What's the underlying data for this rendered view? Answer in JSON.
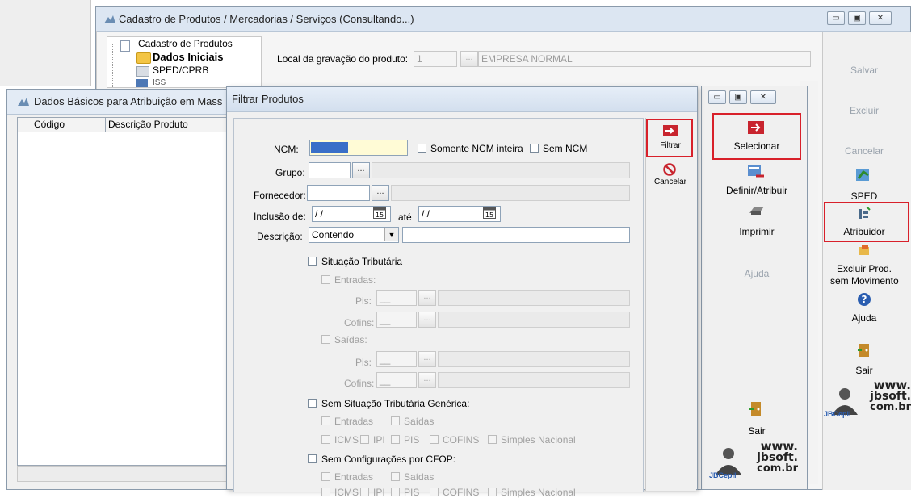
{
  "bg_window": {
    "title": "Cadastro de Produtos / Mercadorias / Serviços (Consultando...)",
    "tree": {
      "root": "Cadastro de Produtos",
      "selected": "Dados Iniciais",
      "item3": "SPED/CPRB",
      "item4": "ISS"
    },
    "storage_label": "Local da gravação do produto:",
    "storage_value": "1",
    "storage_name": "EMPRESA NORMAL",
    "controls": {
      "minimize": "▭",
      "maximize": "▣",
      "close": "✕"
    }
  },
  "right_panel": {
    "salvar": "Salvar",
    "excluir": "Excluir",
    "cancelar": "Cancelar",
    "sped": "SPED",
    "atribuidor": "Atribuidor",
    "excluir_prod_1": "Excluir Prod.",
    "excluir_prod_2": "sem Movimento",
    "ajuda": "Ajuda",
    "sair": "Sair"
  },
  "basic_window": {
    "title": "Dados Básicos para Atribuição em Mass",
    "col_codigo": "Código",
    "col_descricao": "Descrição Produto"
  },
  "middle_panel": {
    "selecionar": "Selecionar",
    "definir": "Definir/Atribuir",
    "imprimir": "Imprimir",
    "ajuda": "Ajuda",
    "sair": "Sair"
  },
  "filter_dialog": {
    "title": "Filtrar Produtos",
    "filtrar": "Filtrar",
    "cancelar": "Cancelar",
    "ncm_label": "NCM:",
    "ncm_value": "",
    "somente_ncm": "Somente NCM inteira",
    "sem_ncm": "Sem NCM",
    "grupo_label": "Grupo:",
    "fornecedor_label": "Fornecedor:",
    "inclusao_label": "Inclusão de:",
    "date_from": " / /",
    "ate": "até",
    "date_to": " / /",
    "descricao_label": "Descrição:",
    "descricao_mode": "Contendo",
    "situacao": "Situação Tributária",
    "entradas": "Entradas:",
    "saidas": "Saídas:",
    "pis": "Pis:",
    "cofins": "Cofins:",
    "sem_situacao": "Sem Situação Tributária Genérica:",
    "entradas2": "Entradas",
    "saidas2": "Saídas",
    "icms": "ICMS",
    "ipi": "IPI",
    "pis2": "PIS",
    "cofins2": "COFINS",
    "simples": "Simples Nacional",
    "sem_cfop": "Sem Configurações por CFOP:",
    "entradas3": "Entradas",
    "saidas3": "Saídas",
    "icms3": "ICMS",
    "ipi3": "IPI",
    "pis3": "PIS",
    "cofins3": "COFINS",
    "simples3": "Simples Nacional"
  },
  "logo": {
    "line1": "www.",
    "line2": "jbsoft.",
    "line3": "com.br",
    "brand": "JBCepil"
  },
  "colors": {
    "accent_red": "#d8202a",
    "title_bar": "#dce6f2",
    "panel": "#f0f0f0"
  }
}
